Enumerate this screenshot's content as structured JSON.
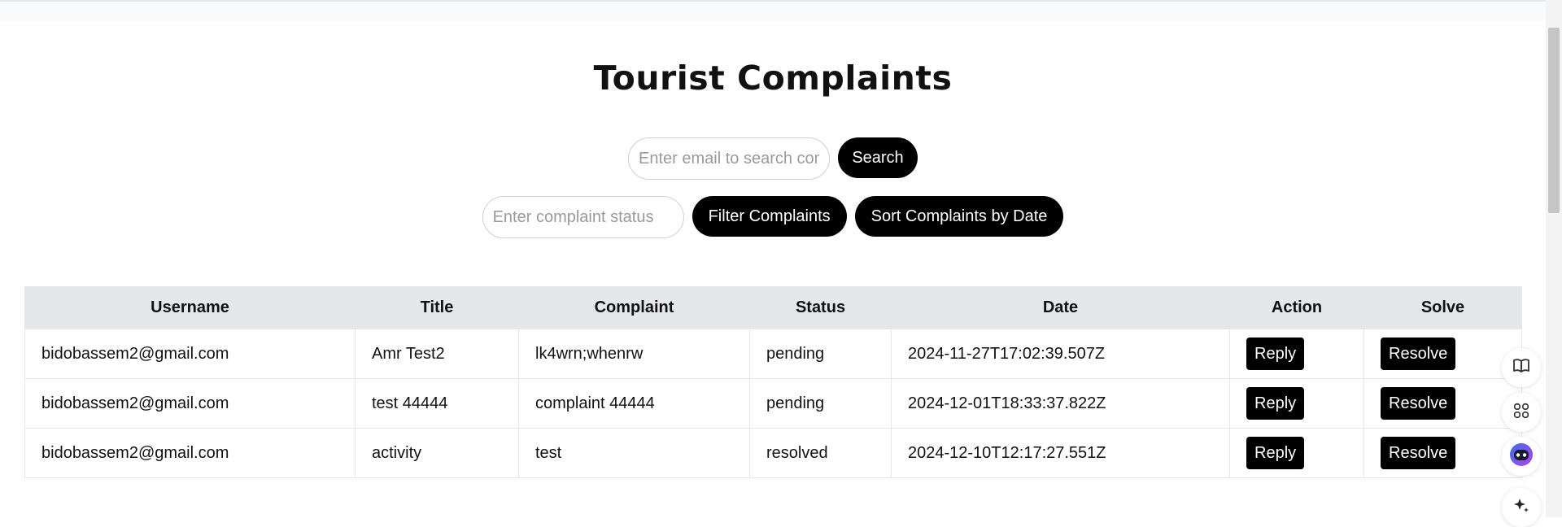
{
  "page": {
    "title": "Tourist Complaints"
  },
  "search": {
    "placeholder": "Enter email to search complaints",
    "button_label": "Search"
  },
  "filter": {
    "placeholder": "Enter complaint status",
    "filter_button_label": "Filter Complaints",
    "sort_button_label": "Sort Complaints by Date"
  },
  "table": {
    "headers": [
      "Username",
      "Title",
      "Complaint",
      "Status",
      "Date",
      "Action",
      "Solve"
    ],
    "rows": [
      {
        "username": "bidobassem2@gmail.com",
        "title": "Amr Test2",
        "complaint": "lk4wrn;whenrw",
        "status": "pending",
        "date": "2024-11-27T17:02:39.507Z",
        "action_label": "Reply",
        "solve_label": "Resolve"
      },
      {
        "username": "bidobassem2@gmail.com",
        "title": "test 44444",
        "complaint": "complaint 44444",
        "status": "pending",
        "date": "2024-12-01T18:33:37.822Z",
        "action_label": "Reply",
        "solve_label": "Resolve"
      },
      {
        "username": "bidobassem2@gmail.com",
        "title": "activity",
        "complaint": "test",
        "status": "resolved",
        "date": "2024-12-10T12:17:27.551Z",
        "action_label": "Reply",
        "solve_label": "Resolve"
      }
    ]
  },
  "side_tools": [
    "book-icon",
    "apps-icon",
    "assistant-face-icon",
    "sparkle-icon"
  ],
  "colors": {
    "button_bg": "#000000",
    "header_bg": "#e5e7eb",
    "assistant_accent": "#6d3df2"
  }
}
